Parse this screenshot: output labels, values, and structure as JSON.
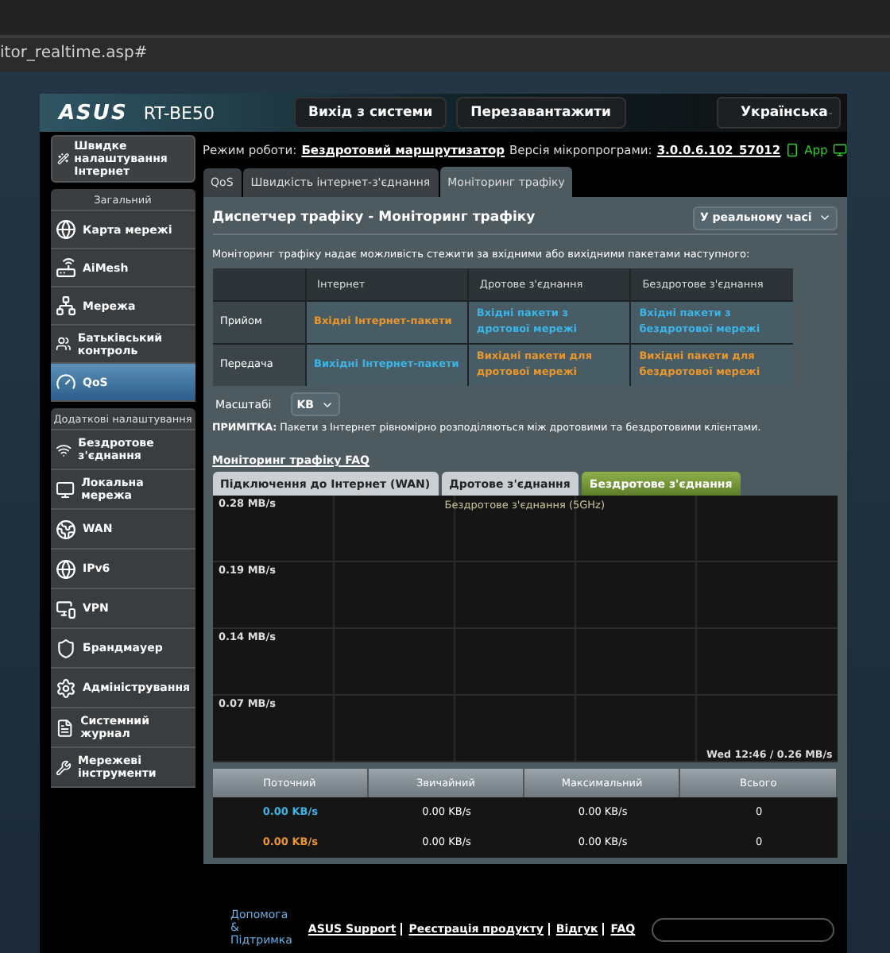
{
  "browser": {
    "address": "itor_realtime.asp#"
  },
  "header": {
    "logo": "ASUS",
    "model": "RT-BE50",
    "buttons": [
      "Вихід з системи",
      "Перезавантажити"
    ],
    "language": "Українська"
  },
  "status": {
    "mode_label": "Режим роботи:",
    "mode": "Бездротовий маршрутизатор",
    "firmware_label": "Версія мікропрограми:",
    "firmware": "3.0.0.6.102_57012",
    "app": "App"
  },
  "sidebar": {
    "quick_setup": "Швидке налаштування Інтернет",
    "sections": [
      {
        "title": "Загальний",
        "items": [
          {
            "label": "Карта мережі",
            "selected": false
          },
          {
            "label": "AiMesh",
            "selected": false
          },
          {
            "label": "Мережа",
            "selected": false
          },
          {
            "label": "Батьківський контроль",
            "selected": false
          },
          {
            "label": "QoS",
            "selected": true
          }
        ]
      },
      {
        "title": "Додаткові налаштування",
        "items": [
          {
            "label": "Бездротове з'єднання",
            "selected": false
          },
          {
            "label": "Локальна мережа",
            "selected": false
          },
          {
            "label": "WAN",
            "selected": false
          },
          {
            "label": "IPv6",
            "selected": false
          },
          {
            "label": "VPN",
            "selected": false
          },
          {
            "label": "Брандмауер",
            "selected": false
          },
          {
            "label": "Адміністрування",
            "selected": false
          },
          {
            "label": "Системний журнал",
            "selected": false
          },
          {
            "label": "Мережеві інструменти",
            "selected": false
          }
        ]
      }
    ]
  },
  "tabs": [
    {
      "label": "QoS",
      "selected": false
    },
    {
      "label": "Швидкість інтернет-з'єднання",
      "selected": false
    },
    {
      "label": "Моніторинг трафіку",
      "selected": true
    }
  ],
  "panel": {
    "title": "Диспетчер трафіку - Моніторинг трафіку",
    "period": "У реальному часі",
    "description": "Моніторинг трафіку надає можливість стежити за вхідними або вихідними пакетами наступного:",
    "table": {
      "columns": [
        "Інтернет",
        "Дротове з'єднання",
        "Бездротове з'єднання"
      ],
      "rows": [
        {
          "label": "Прийом",
          "cells": [
            {
              "text": "Вхідні Інтернет-пакети",
              "color": "#e8962d"
            },
            {
              "text": "Вхідні пакети з дротової мережі",
              "color": "#3cb4e6"
            },
            {
              "text": "Вхідні пакети з бездротової мережі",
              "color": "#3cb4e6"
            }
          ]
        },
        {
          "label": "Передача",
          "cells": [
            {
              "text": "Вихідні Інтернет-пакети",
              "color": "#3cb4e6"
            },
            {
              "text": "Вихідні пакети для дротової мережі",
              "color": "#e8962d"
            },
            {
              "text": "Вихідні пакети для бездротової мережі",
              "color": "#e8962d"
            }
          ]
        }
      ]
    },
    "scale_label": "Масштабі",
    "scale": "KB",
    "note_label": "ПРИМІТКА:",
    "note": "Пакети з Інтернет рівномірно розподіляються між дротовими та бездротовими клієнтами.",
    "faq": "Моніторинг трафіку FAQ",
    "graph_tabs": [
      {
        "label": "Підключення до Інтернет (WAN)",
        "selected": false
      },
      {
        "label": "Дротове з'єднання",
        "selected": false
      },
      {
        "label": "Бездротове з'єднання",
        "selected": true
      }
    ],
    "graph": {
      "title": "Бездротове з'єднання (5GHz)",
      "y_labels": [
        "0.28 MB/s",
        "0.19 MB/s",
        "0.14 MB/s",
        "0.07 MB/s"
      ],
      "readout": "Wed 12:46 / 0.26 MB/s"
    },
    "stats": {
      "columns": [
        "Поточний",
        "Звичайний",
        "Максимальний",
        "Всього"
      ],
      "rows": [
        {
          "color": "#3cb4e6",
          "cells": [
            "0.00 KB/s",
            "0.00 KB/s",
            "0.00 KB/s",
            "0"
          ]
        },
        {
          "color": "#e8962d",
          "cells": [
            "0.00 KB/s",
            "0.00 KB/s",
            "0.00 KB/s",
            "0"
          ]
        }
      ]
    }
  },
  "footer": {
    "help": "Допомога & Підтримка",
    "links": [
      "ASUS Support",
      "Реєстрація продукту",
      "Відгук",
      "FAQ"
    ]
  }
}
